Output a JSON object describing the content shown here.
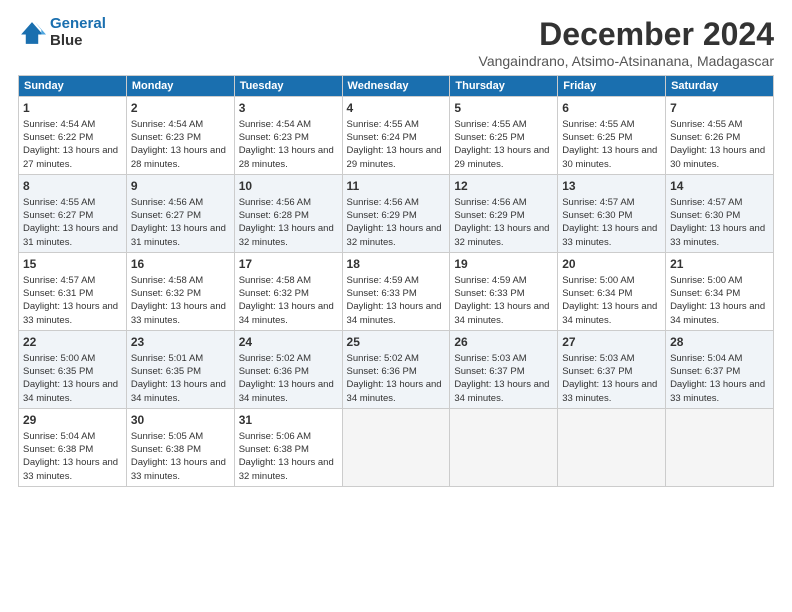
{
  "logo": {
    "line1": "General",
    "line2": "Blue"
  },
  "title": "December 2024",
  "subtitle": "Vangaindrano, Atsimo-Atsinanana, Madagascar",
  "headers": [
    "Sunday",
    "Monday",
    "Tuesday",
    "Wednesday",
    "Thursday",
    "Friday",
    "Saturday"
  ],
  "weeks": [
    [
      {
        "day": "1",
        "rise": "4:54 AM",
        "set": "6:22 PM",
        "hours": "13 hours and 27 minutes."
      },
      {
        "day": "2",
        "rise": "4:54 AM",
        "set": "6:23 PM",
        "hours": "13 hours and 28 minutes."
      },
      {
        "day": "3",
        "rise": "4:54 AM",
        "set": "6:23 PM",
        "hours": "13 hours and 28 minutes."
      },
      {
        "day": "4",
        "rise": "4:55 AM",
        "set": "6:24 PM",
        "hours": "13 hours and 29 minutes."
      },
      {
        "day": "5",
        "rise": "4:55 AM",
        "set": "6:25 PM",
        "hours": "13 hours and 29 minutes."
      },
      {
        "day": "6",
        "rise": "4:55 AM",
        "set": "6:25 PM",
        "hours": "13 hours and 30 minutes."
      },
      {
        "day": "7",
        "rise": "4:55 AM",
        "set": "6:26 PM",
        "hours": "13 hours and 30 minutes."
      }
    ],
    [
      {
        "day": "8",
        "rise": "4:55 AM",
        "set": "6:27 PM",
        "hours": "13 hours and 31 minutes."
      },
      {
        "day": "9",
        "rise": "4:56 AM",
        "set": "6:27 PM",
        "hours": "13 hours and 31 minutes."
      },
      {
        "day": "10",
        "rise": "4:56 AM",
        "set": "6:28 PM",
        "hours": "13 hours and 32 minutes."
      },
      {
        "day": "11",
        "rise": "4:56 AM",
        "set": "6:29 PM",
        "hours": "13 hours and 32 minutes."
      },
      {
        "day": "12",
        "rise": "4:56 AM",
        "set": "6:29 PM",
        "hours": "13 hours and 32 minutes."
      },
      {
        "day": "13",
        "rise": "4:57 AM",
        "set": "6:30 PM",
        "hours": "13 hours and 33 minutes."
      },
      {
        "day": "14",
        "rise": "4:57 AM",
        "set": "6:30 PM",
        "hours": "13 hours and 33 minutes."
      }
    ],
    [
      {
        "day": "15",
        "rise": "4:57 AM",
        "set": "6:31 PM",
        "hours": "13 hours and 33 minutes."
      },
      {
        "day": "16",
        "rise": "4:58 AM",
        "set": "6:32 PM",
        "hours": "13 hours and 33 minutes."
      },
      {
        "day": "17",
        "rise": "4:58 AM",
        "set": "6:32 PM",
        "hours": "13 hours and 34 minutes."
      },
      {
        "day": "18",
        "rise": "4:59 AM",
        "set": "6:33 PM",
        "hours": "13 hours and 34 minutes."
      },
      {
        "day": "19",
        "rise": "4:59 AM",
        "set": "6:33 PM",
        "hours": "13 hours and 34 minutes."
      },
      {
        "day": "20",
        "rise": "5:00 AM",
        "set": "6:34 PM",
        "hours": "13 hours and 34 minutes."
      },
      {
        "day": "21",
        "rise": "5:00 AM",
        "set": "6:34 PM",
        "hours": "13 hours and 34 minutes."
      }
    ],
    [
      {
        "day": "22",
        "rise": "5:00 AM",
        "set": "6:35 PM",
        "hours": "13 hours and 34 minutes."
      },
      {
        "day": "23",
        "rise": "5:01 AM",
        "set": "6:35 PM",
        "hours": "13 hours and 34 minutes."
      },
      {
        "day": "24",
        "rise": "5:02 AM",
        "set": "6:36 PM",
        "hours": "13 hours and 34 minutes."
      },
      {
        "day": "25",
        "rise": "5:02 AM",
        "set": "6:36 PM",
        "hours": "13 hours and 34 minutes."
      },
      {
        "day": "26",
        "rise": "5:03 AM",
        "set": "6:37 PM",
        "hours": "13 hours and 34 minutes."
      },
      {
        "day": "27",
        "rise": "5:03 AM",
        "set": "6:37 PM",
        "hours": "13 hours and 33 minutes."
      },
      {
        "day": "28",
        "rise": "5:04 AM",
        "set": "6:37 PM",
        "hours": "13 hours and 33 minutes."
      }
    ],
    [
      {
        "day": "29",
        "rise": "5:04 AM",
        "set": "6:38 PM",
        "hours": "13 hours and 33 minutes."
      },
      {
        "day": "30",
        "rise": "5:05 AM",
        "set": "6:38 PM",
        "hours": "13 hours and 33 minutes."
      },
      {
        "day": "31",
        "rise": "5:06 AM",
        "set": "6:38 PM",
        "hours": "13 hours and 32 minutes."
      },
      null,
      null,
      null,
      null
    ]
  ]
}
